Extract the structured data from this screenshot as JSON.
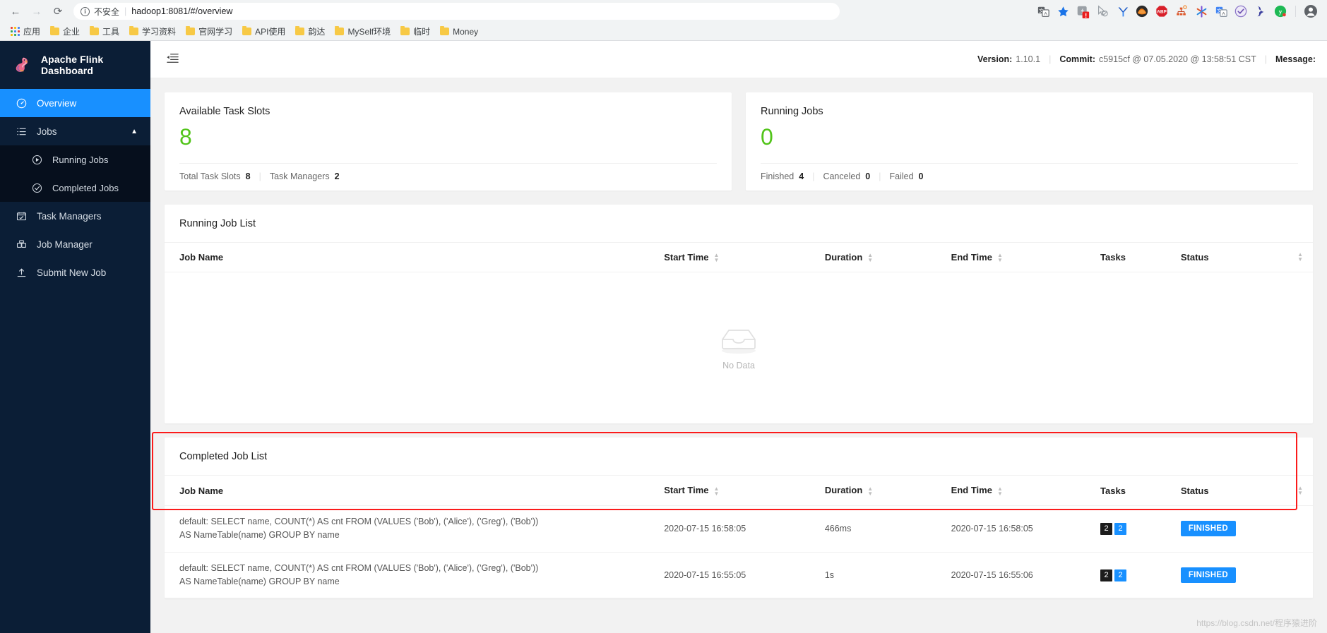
{
  "browser": {
    "nav": {
      "back": "←",
      "forward": "→",
      "reload": "⟳"
    },
    "omnibox": {
      "info_icon": "info-icon",
      "security_label": "不安全",
      "url": "hadoop1:8081/#/overview"
    },
    "toolbar_icons": [
      "translate-icon",
      "bookmark-star-icon",
      "extension-broken-icon",
      "cursor-blocked-icon",
      "yandex-icon",
      "adobe-icon",
      "adblock-plus-icon",
      "network-graph-icon",
      "asterisk-icon",
      "google-translate-icon",
      "checkmark-circle-icon",
      "s-wave-icon",
      "yammer-icon",
      "profile-avatar-icon"
    ],
    "bookmarks": [
      {
        "icon": "apps-grid-icon",
        "label": "应用"
      },
      {
        "icon": "folder-icon",
        "label": "企业"
      },
      {
        "icon": "folder-icon",
        "label": "工具"
      },
      {
        "icon": "folder-icon",
        "label": "学习资料"
      },
      {
        "icon": "folder-icon",
        "label": "官网学习"
      },
      {
        "icon": "folder-icon",
        "label": "API使用"
      },
      {
        "icon": "folder-icon",
        "label": "韵达"
      },
      {
        "icon": "folder-icon",
        "label": "MySelf环境"
      },
      {
        "icon": "folder-icon",
        "label": "临时"
      },
      {
        "icon": "folder-icon",
        "label": "Money"
      }
    ]
  },
  "sidebar": {
    "brand": "Apache Flink Dashboard",
    "items": [
      {
        "label": "Overview",
        "icon": "dashboard-icon",
        "active": true
      },
      {
        "label": "Jobs",
        "icon": "list-icon",
        "active": false,
        "expandable": true
      },
      {
        "label": "Running Jobs",
        "icon": "play-circle-icon",
        "sub": true
      },
      {
        "label": "Completed Jobs",
        "icon": "check-circle-icon",
        "sub": true
      },
      {
        "label": "Task Managers",
        "icon": "task-manager-icon",
        "active": false
      },
      {
        "label": "Job Manager",
        "icon": "job-manager-icon",
        "active": false
      },
      {
        "label": "Submit New Job",
        "icon": "upload-icon",
        "active": false
      }
    ]
  },
  "topbar": {
    "menu_toggle_icon": "menu-fold-icon",
    "version_label": "Version:",
    "version_value": "1.10.1",
    "commit_label": "Commit:",
    "commit_value": "c5915cf @ 07.05.2020 @ 13:58:51 CST",
    "message_label": "Message:"
  },
  "stats": {
    "task_slots": {
      "title": "Available Task Slots",
      "value": "8",
      "footer": [
        {
          "label": "Total Task Slots",
          "value": "8"
        },
        {
          "label": "Task Managers",
          "value": "2"
        }
      ]
    },
    "running_jobs": {
      "title": "Running Jobs",
      "value": "0",
      "footer": [
        {
          "label": "Finished",
          "value": "4"
        },
        {
          "label": "Canceled",
          "value": "0"
        },
        {
          "label": "Failed",
          "value": "0"
        }
      ]
    }
  },
  "running_job_list": {
    "title": "Running Job List",
    "columns": [
      "Job Name",
      "Start Time",
      "Duration",
      "End Time",
      "Tasks",
      "Status"
    ],
    "empty_text": "No Data",
    "empty_icon": "inbox-icon",
    "rows": []
  },
  "completed_job_list": {
    "title": "Completed Job List",
    "columns": [
      "Job Name",
      "Start Time",
      "Duration",
      "End Time",
      "Tasks",
      "Status"
    ],
    "rows": [
      {
        "job_name": "default: SELECT name, COUNT(*) AS cnt FROM (VALUES ('Bob'), ('Alice'), ('Greg'), ('Bob')) AS NameTable(name) GROUP BY name",
        "start_time": "2020-07-15 16:58:05",
        "duration": "466ms",
        "end_time": "2020-07-15 16:58:05",
        "tasks": [
          "2",
          "2"
        ],
        "status": "FINISHED"
      },
      {
        "job_name": "default: SELECT name, COUNT(*) AS cnt FROM (VALUES ('Bob'), ('Alice'), ('Greg'), ('Bob')) AS NameTable(name) GROUP BY name",
        "start_time": "2020-07-15 16:55:05",
        "duration": "1s",
        "end_time": "2020-07-15 16:55:06",
        "tasks": [
          "2",
          "2"
        ],
        "status": "FINISHED"
      }
    ]
  },
  "watermark": "https://blog.csdn.net/程序猿进阶",
  "colors": {
    "accent": "#1890ff",
    "success": "#52c41a",
    "sidebar_bg": "#0b1e36",
    "highlight_box": "#fb1b1b"
  }
}
